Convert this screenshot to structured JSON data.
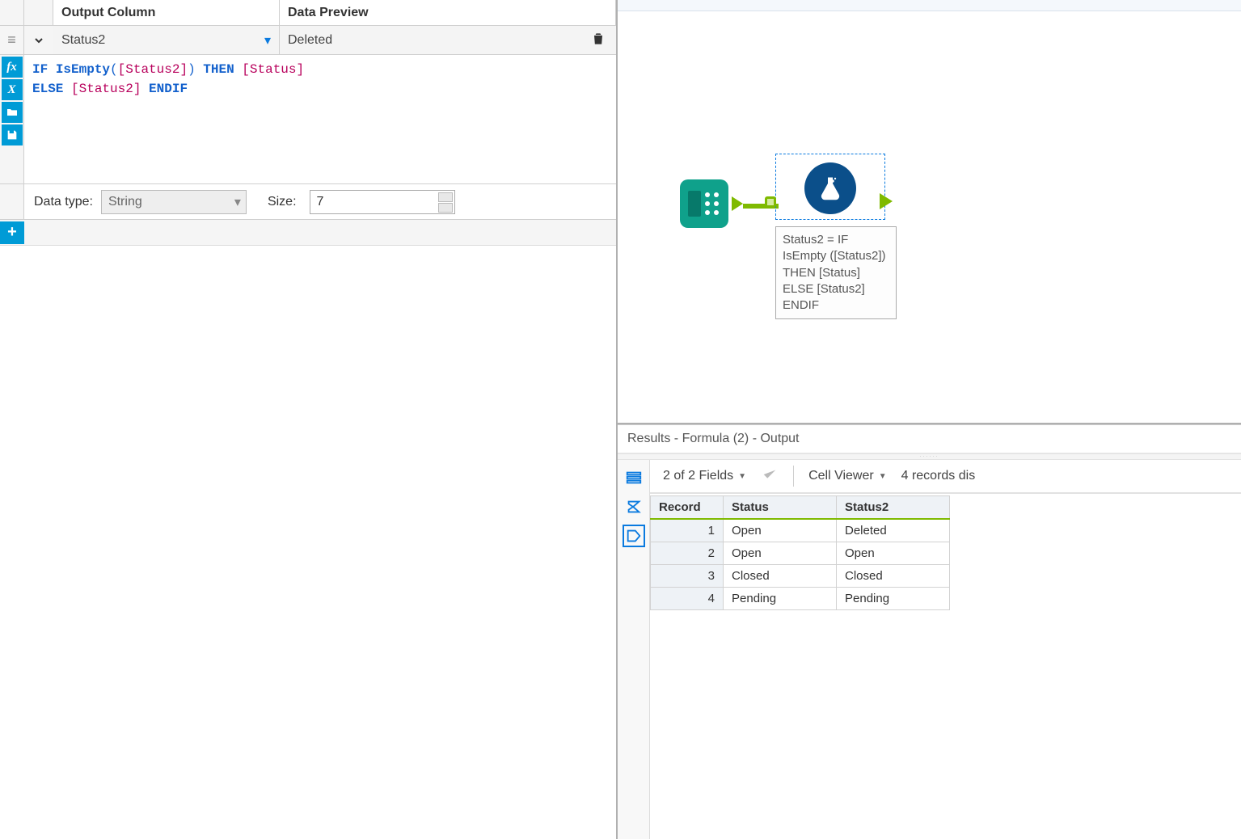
{
  "config": {
    "headers": {
      "output": "Output Column",
      "preview": "Data Preview"
    },
    "selected_column": "Status2",
    "preview_value": "Deleted",
    "formula_tokens": [
      {
        "t": "kw",
        "v": "IF"
      },
      {
        "t": "sp",
        "v": " "
      },
      {
        "t": "func",
        "v": "IsEmpty"
      },
      {
        "t": "paren",
        "v": "("
      },
      {
        "t": "field",
        "v": "[Status2]"
      },
      {
        "t": "paren",
        "v": ")"
      },
      {
        "t": "sp",
        "v": " "
      },
      {
        "t": "kw",
        "v": "THEN"
      },
      {
        "t": "sp",
        "v": " "
      },
      {
        "t": "field",
        "v": "[Status]"
      },
      {
        "t": "br",
        "v": ""
      },
      {
        "t": "kw",
        "v": "ELSE"
      },
      {
        "t": "sp",
        "v": " "
      },
      {
        "t": "field",
        "v": "[Status2]"
      },
      {
        "t": "sp",
        "v": " "
      },
      {
        "t": "kw",
        "v": "ENDIF"
      }
    ],
    "data_type_label": "Data type:",
    "data_type_value": "String",
    "size_label": "Size:",
    "size_value": "7"
  },
  "canvas": {
    "annotation": "Status2 = IF IsEmpty ([Status2]) THEN [Status]\nELSE [Status2] ENDIF"
  },
  "results": {
    "title": "Results - Formula (2) - Output",
    "fields_summary": "2 of 2 Fields",
    "cell_viewer_label": "Cell Viewer",
    "records_summary": "4 records dis",
    "columns": [
      "Record",
      "Status",
      "Status2"
    ],
    "rows": [
      {
        "Record": "1",
        "Status": "Open",
        "Status2": "Deleted"
      },
      {
        "Record": "2",
        "Status": "Open",
        "Status2": "Open"
      },
      {
        "Record": "3",
        "Status": "Closed",
        "Status2": "Closed"
      },
      {
        "Record": "4",
        "Status": "Pending",
        "Status2": "Pending"
      }
    ]
  }
}
